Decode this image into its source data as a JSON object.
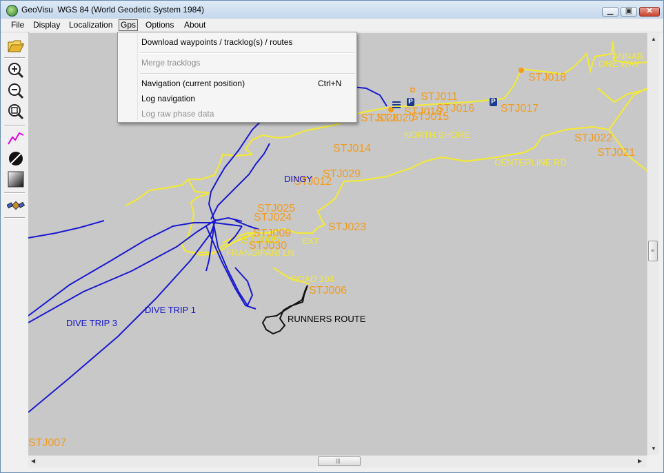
{
  "window": {
    "app_name": "GeoVisu",
    "datum": "WGS 84 (World Geodetic System 1984)"
  },
  "menu": [
    {
      "id": "file",
      "label": "File"
    },
    {
      "id": "display",
      "label": "Display"
    },
    {
      "id": "localization",
      "label": "Localization"
    },
    {
      "id": "gps",
      "label": "Gps"
    },
    {
      "id": "options",
      "label": "Options"
    },
    {
      "id": "about",
      "label": "About"
    }
  ],
  "gps_menu": {
    "download": "Download waypoints / tracklog(s) / routes",
    "merge": "Merge tracklogs",
    "navigation": "Navigation (current position)",
    "navigation_shortcut": "Ctrl+N",
    "log_navigation": "Log navigation",
    "log_raw": "Log raw phase data"
  },
  "toolbar": [
    "open-folder-icon",
    "zoom-in-icon",
    "zoom-out-icon",
    "zoom-fit-icon",
    "track-icon",
    "route-icon",
    "shading-icon",
    "satellite-icon"
  ],
  "map": {
    "waypoints": [
      "STJ011",
      "STJ016",
      "STJ015",
      "STJ010",
      "STJ020",
      "STJ028",
      "STJ018",
      "STJ017",
      "STJ014",
      "STJ022",
      "STJ021",
      "STJ029",
      "STJ012",
      "STJ025",
      "STJ024",
      "STJ023",
      "STJ009",
      "STJ005",
      "STJ030",
      "STJ006",
      "STJ007"
    ],
    "roads": [
      "NORTH SHORE",
      "CENTERLINE RD",
      "ONE WAY",
      "ANNAB",
      "EXT",
      "FRANGIPANI LN",
      "ROAD 104",
      "DINGY"
    ],
    "tracks": [
      "DIVE TRIP 1",
      "DIVE TRIP 3",
      "RUNNERS ROUTE"
    ]
  },
  "colors": {
    "map_bg": "#c8c8c8",
    "waypoint": "#f39b1c",
    "road": "#f2e83a",
    "track": "#1010c8"
  }
}
